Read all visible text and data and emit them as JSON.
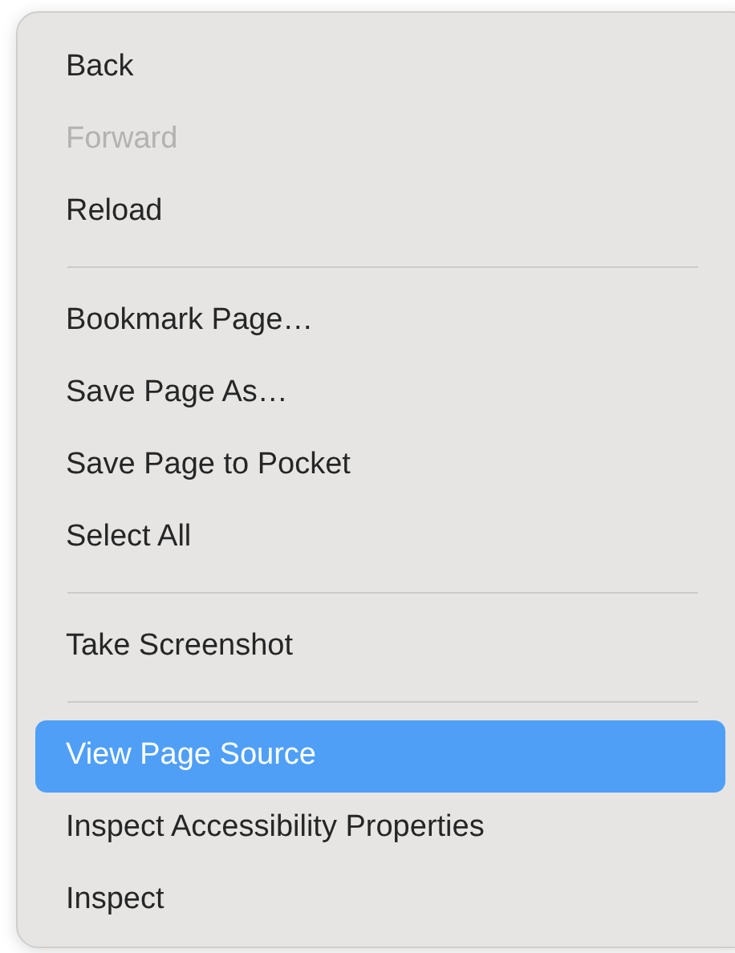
{
  "menu": {
    "groups": [
      {
        "items": [
          {
            "label": "Back",
            "disabled": false,
            "selected": false
          },
          {
            "label": "Forward",
            "disabled": true,
            "selected": false
          },
          {
            "label": "Reload",
            "disabled": false,
            "selected": false
          }
        ]
      },
      {
        "items": [
          {
            "label": "Bookmark Page…",
            "disabled": false,
            "selected": false
          },
          {
            "label": "Save Page As…",
            "disabled": false,
            "selected": false
          },
          {
            "label": "Save Page to Pocket",
            "disabled": false,
            "selected": false
          },
          {
            "label": "Select All",
            "disabled": false,
            "selected": false
          }
        ]
      },
      {
        "items": [
          {
            "label": "Take Screenshot",
            "disabled": false,
            "selected": false
          }
        ]
      },
      {
        "items": [
          {
            "label": "View Page Source",
            "disabled": false,
            "selected": true
          },
          {
            "label": "Inspect Accessibility Properties",
            "disabled": false,
            "selected": false
          },
          {
            "label": "Inspect",
            "disabled": false,
            "selected": false
          }
        ]
      }
    ]
  }
}
